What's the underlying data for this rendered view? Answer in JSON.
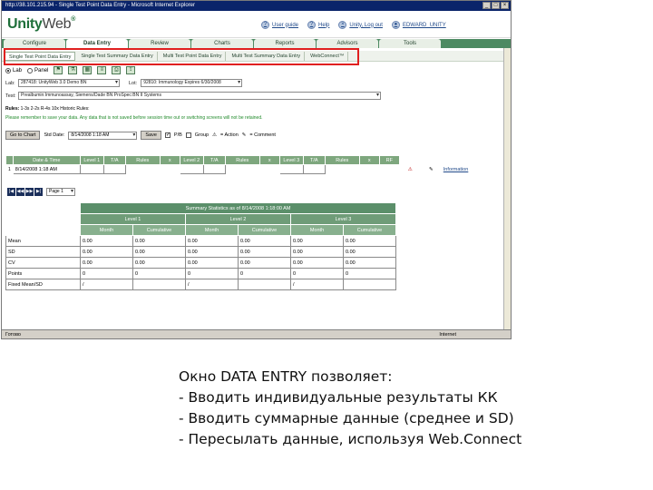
{
  "window": {
    "title": "http://38.101.215.94 - Single Test Point Data Entry - Microsoft Internet Explorer",
    "status_left": "Готово",
    "status_right": "Internet"
  },
  "brand": {
    "name": "Unity",
    "name2": "Web",
    "reg": "®"
  },
  "toplinks": [
    {
      "icon": "user-guide-icon",
      "glyph": "?",
      "label": "User guide"
    },
    {
      "icon": "help-icon",
      "glyph": "?",
      "label": "Help"
    },
    {
      "icon": "logout-icon",
      "glyph": "×",
      "label": "Unity, Log out"
    },
    {
      "icon": "user-icon",
      "glyph": "●",
      "label": "EDWARD_UNITY"
    }
  ],
  "navtabs": [
    "Configure",
    "Data Entry",
    "Review",
    "Charts",
    "Reports",
    "Advisors",
    "Tools"
  ],
  "subtabs": [
    "Single Test Point Data Entry",
    "Single Test Summary Data Entry",
    "Multi Test Point Data Entry",
    "Multi Test Summary Data Entry",
    "WebConnect™"
  ],
  "view": {
    "radio_1": "Lab",
    "radio_2": "Panel"
  },
  "fields": {
    "lab_label": "Lab:",
    "lab_value": "287418: UnityWeb 3.0 Demo BN",
    "lot_label": "Lot:",
    "lot_value": "92810: Immunology Expires 6/30/2008",
    "test_label": "Test:",
    "test_value": "Prealbumin:Immunoassay, Siemens/Dade BN ProSpec:BN II Systems"
  },
  "notes": {
    "rules_label": "Rules:",
    "rules_text": "1-3s 2-2s R-4s 10x  Historic Rules:",
    "warning": "Please remember to save your data. Any data that is not saved before session time out or switching screens will not be retained."
  },
  "controls": {
    "chart_button": "Go to Chart",
    "date_label": "Std Date:",
    "date_value": "8/14/2008 1:18 AM",
    "save_button": "Save",
    "pwb_label": "P/B",
    "group_label": "Group",
    "action_label": "= Action",
    "comment_label": "= Comment"
  },
  "grid": {
    "headers": [
      "Date & Time",
      "Level 1",
      "T/A",
      "Rules",
      "x",
      "Level 2",
      "T/A",
      "Rules",
      "x",
      "Level 3",
      "T/A",
      "Rules",
      "x",
      "RF"
    ],
    "row_number": "1",
    "row_date": "8/14/2008 1:18 AM",
    "info_link": "Information"
  },
  "pager": {
    "page_label": "Page 1"
  },
  "summary": {
    "title": "Summary Statistics as of 8/14/2008 1:18:00 AM",
    "levels": [
      "Level 1",
      "Level 2",
      "Level 3"
    ],
    "sub_headers": [
      "Month",
      "Cumulative",
      "Month",
      "Cumulative",
      "Month",
      "Cumulative"
    ],
    "rows": [
      {
        "label": "Mean",
        "values": [
          "0.00",
          "0.00",
          "0.00",
          "0.00",
          "0.00",
          "0.00"
        ]
      },
      {
        "label": "SD",
        "values": [
          "0.00",
          "0.00",
          "0.00",
          "0.00",
          "0.00",
          "0.00"
        ]
      },
      {
        "label": "CV",
        "values": [
          "0.00",
          "0.00",
          "0.00",
          "0.00",
          "0.00",
          "0.00"
        ]
      },
      {
        "label": "Points",
        "values": [
          "0",
          "0",
          "0",
          "0",
          "0",
          "0"
        ]
      },
      {
        "label": "Fixed Mean/SD",
        "values": [
          "/",
          "",
          "/",
          "",
          "/",
          ""
        ]
      }
    ]
  },
  "caption": {
    "line1": "Окно DATA ENTRY позволяет:",
    "line2": "- Вводить индивидуальные результаты КК",
    "line3": "- Вводить суммарные данные (среднее и SD)",
    "line4": "- Пересылать данные, используя Web.Connect"
  }
}
